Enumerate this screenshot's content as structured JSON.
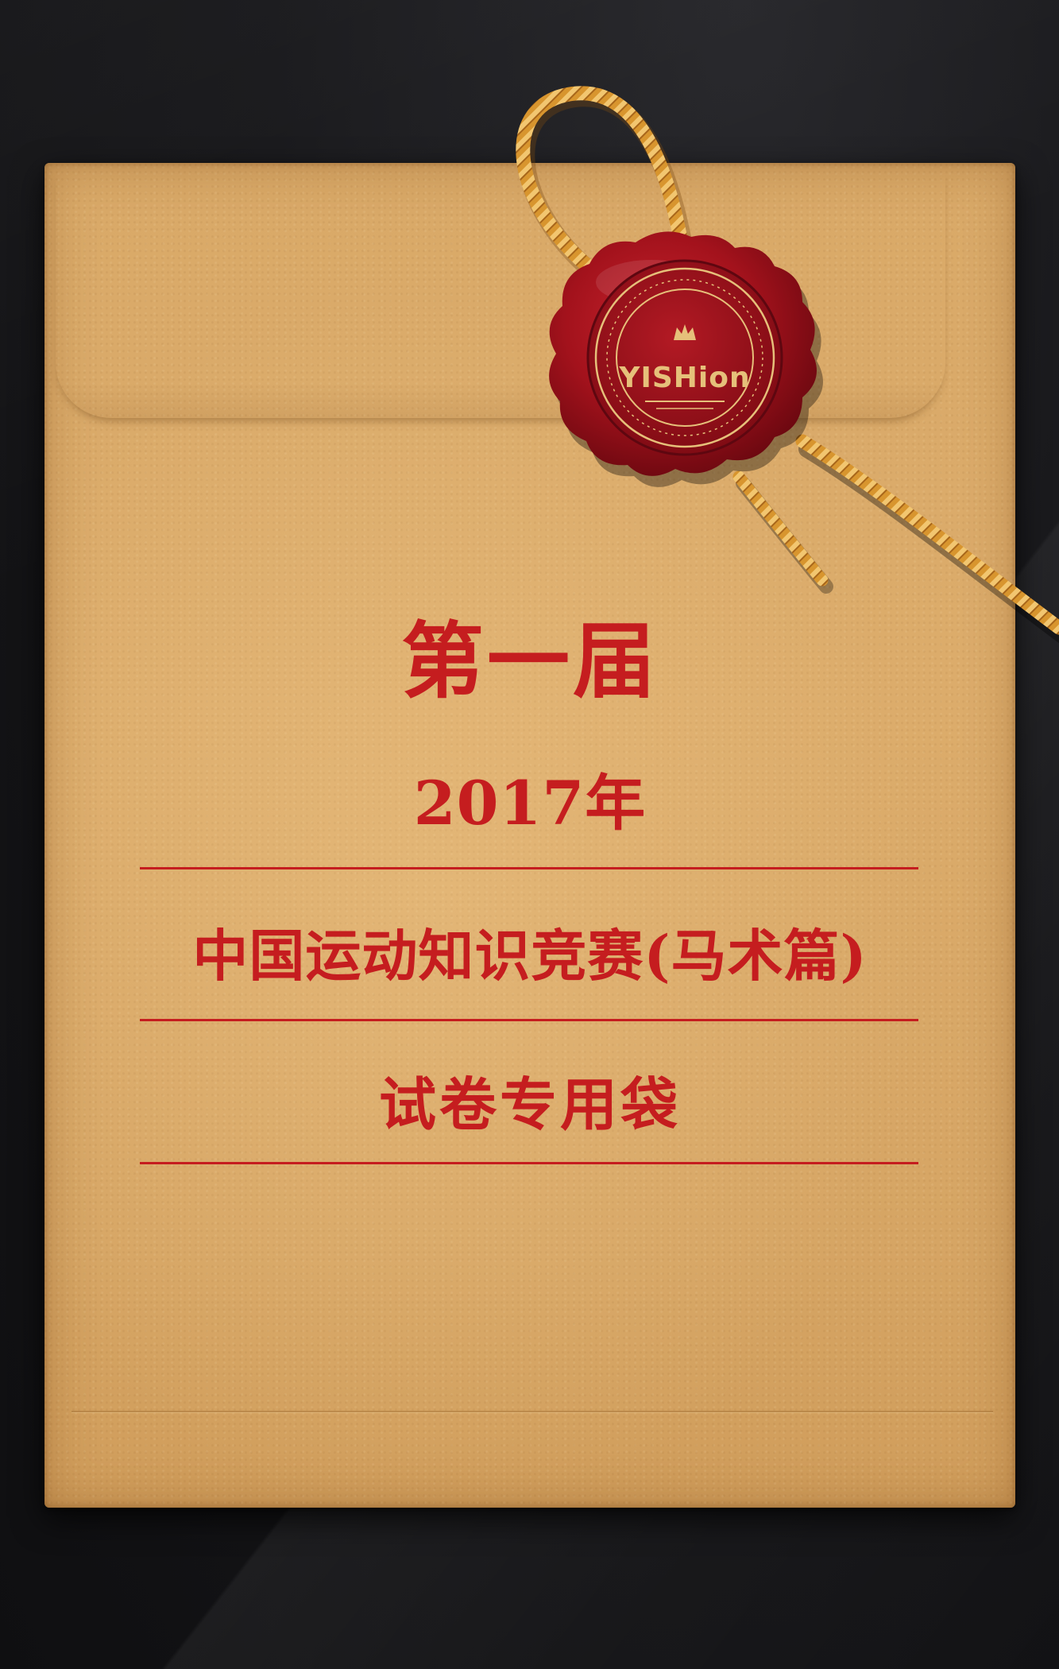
{
  "envelope": {
    "edition": "第一届",
    "year": "2017年",
    "title": "中国运动知识竞赛(马术篇)",
    "subtitle": "试卷专用袋"
  },
  "seal": {
    "brand": "YISHion",
    "icon": "crown-icon"
  },
  "colors": {
    "accent_red": "#c51d1f",
    "kraft": "#d9a968",
    "wax": "#9e1019",
    "seal_gold": "#e6c07a",
    "background": "#141416"
  }
}
